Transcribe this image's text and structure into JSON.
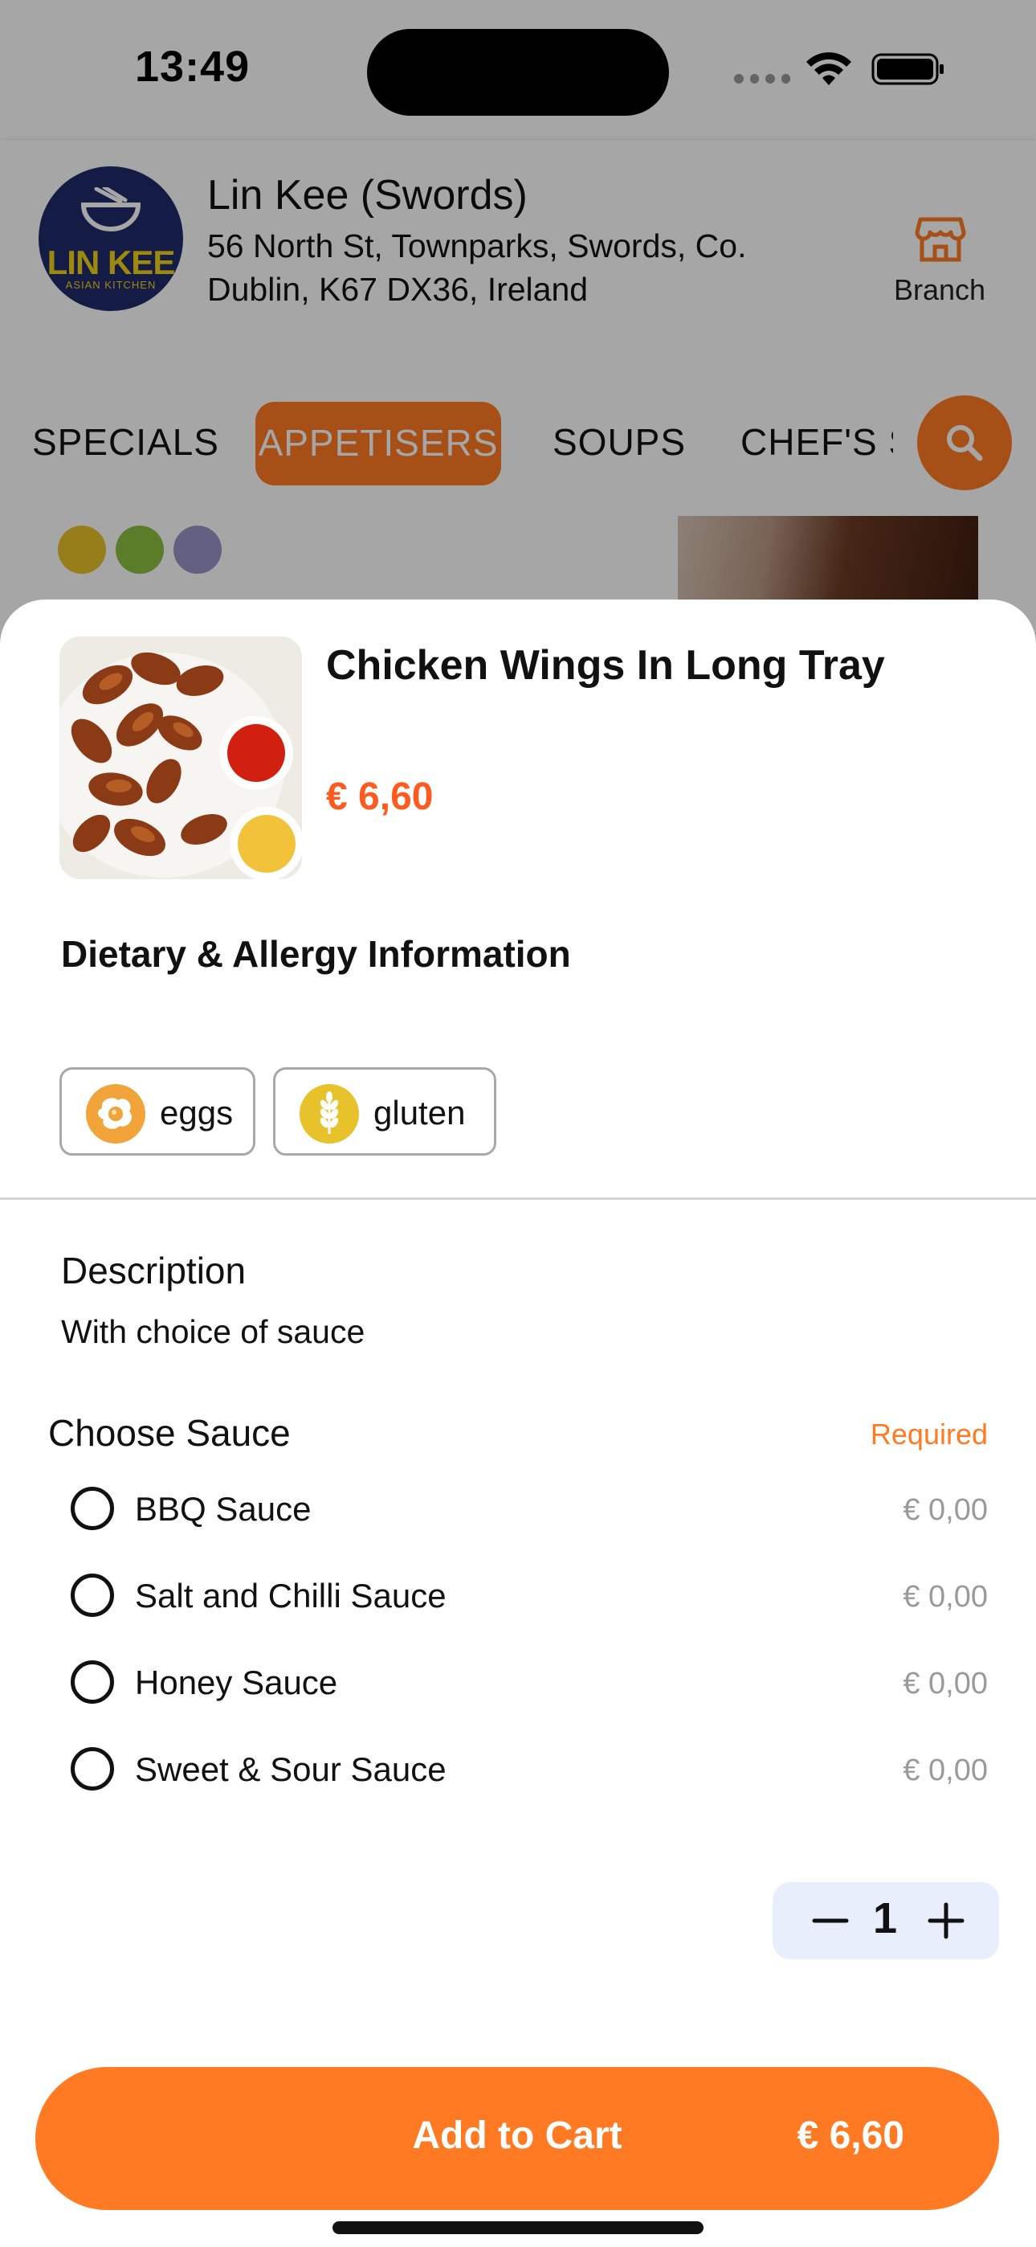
{
  "status_bar": {
    "time": "13:49"
  },
  "store": {
    "logo_text": "LIN KEE",
    "logo_sub": "ASIAN KITCHEN",
    "name": "Lin Kee (Swords)",
    "address": "56 North St, Townparks, Swords, Co. Dublin, K67 DX36, Ireland",
    "branch_label": "Branch"
  },
  "categories": {
    "items": [
      "SPECIALS",
      "APPETISERS",
      "SOUPS",
      "CHEF'S S"
    ],
    "active": "APPETISERS"
  },
  "item": {
    "title": "Chicken Wings In Long Tray",
    "price": "€ 6,60",
    "dietary_title": "Dietary & Allergy Information",
    "allergens": [
      {
        "label": "eggs",
        "icon": "egg-icon",
        "color": "#f0a43a"
      },
      {
        "label": "gluten",
        "icon": "wheat-icon",
        "color": "#e8c22a"
      }
    ],
    "description_title": "Description",
    "description": "With choice of sauce"
  },
  "options_group": {
    "title": "Choose Sauce",
    "required_label": "Required",
    "options": [
      {
        "label": "BBQ Sauce",
        "price": "€ 0,00"
      },
      {
        "label": "Salt and Chilli Sauce",
        "price": "€ 0,00"
      },
      {
        "label": "Honey Sauce",
        "price": "€ 0,00"
      },
      {
        "label": "Sweet & Sour Sauce",
        "price": "€ 0,00"
      }
    ]
  },
  "quantity": {
    "value": "1"
  },
  "cart_button": {
    "label": "Add to Cart",
    "price": "€ 6,60"
  },
  "colors": {
    "accent": "#ff7a22",
    "price": "#ff5a1f",
    "qty_bg": "#e8eefb"
  }
}
